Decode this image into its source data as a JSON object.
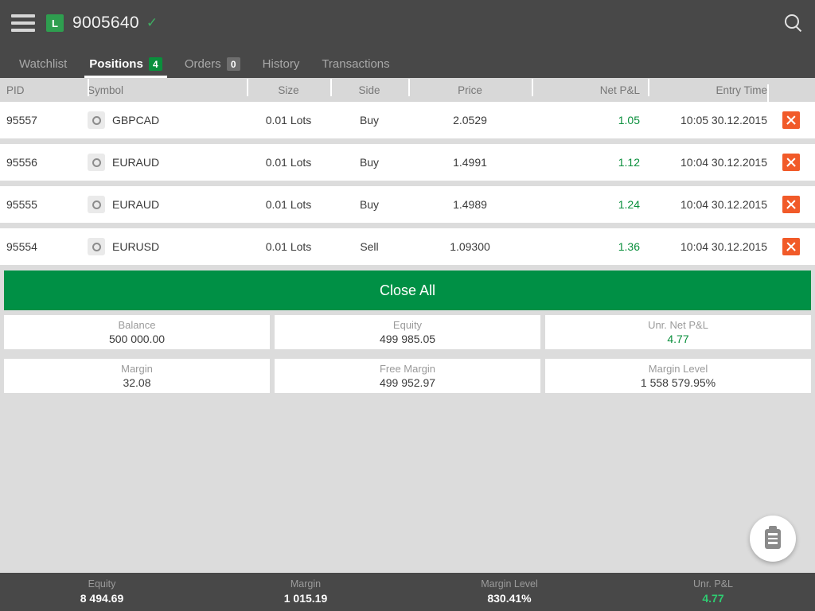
{
  "header": {
    "menu_icon": "hamburger-menu-icon",
    "account_badge": "L",
    "account_number": "9005640",
    "account_check": "✓",
    "search_icon": "search-icon"
  },
  "tabs": [
    {
      "label": "Watchlist",
      "badge": null,
      "active": false
    },
    {
      "label": "Positions",
      "badge": "4",
      "active": true
    },
    {
      "label": "Orders",
      "badge": "0",
      "active": false
    },
    {
      "label": "History",
      "badge": null,
      "active": false
    },
    {
      "label": "Transactions",
      "badge": null,
      "active": false
    }
  ],
  "table": {
    "columns": [
      "PID",
      "Symbol",
      "Size",
      "Side",
      "Price",
      "Net P&L",
      "Entry Time"
    ],
    "rows": [
      {
        "pid": "95557",
        "symbol": "GBPCAD",
        "size": "0.01 Lots",
        "side": "Buy",
        "price": "2.0529",
        "pnl": "1.05",
        "time": "10:05 30.12.2015"
      },
      {
        "pid": "95556",
        "symbol": "EURAUD",
        "size": "0.01 Lots",
        "side": "Buy",
        "price": "1.4991",
        "pnl": "1.12",
        "time": "10:04 30.12.2015"
      },
      {
        "pid": "95555",
        "symbol": "EURAUD",
        "size": "0.01 Lots",
        "side": "Buy",
        "price": "1.4989",
        "pnl": "1.24",
        "time": "10:04 30.12.2015"
      },
      {
        "pid": "95554",
        "symbol": "EURUSD",
        "size": "0.01 Lots",
        "side": "Sell",
        "price": "1.09300",
        "pnl": "1.36",
        "time": "10:04 30.12.2015"
      }
    ]
  },
  "close_all_label": "Close All",
  "summary": [
    {
      "label": "Balance",
      "value": "500 000.00",
      "green": false
    },
    {
      "label": "Equity",
      "value": "499 985.05",
      "green": false
    },
    {
      "label": "Unr. Net P&L",
      "value": "4.77",
      "green": true
    },
    {
      "label": "Margin",
      "value": "32.08",
      "green": false
    },
    {
      "label": "Free Margin",
      "value": "499 952.97",
      "green": false
    },
    {
      "label": "Margin Level",
      "value": "1 558 579.95%",
      "green": false
    }
  ],
  "fab": {
    "icon": "clipboard-icon"
  },
  "statusbar": [
    {
      "label": "Equity",
      "value": "8 494.69",
      "green": false
    },
    {
      "label": "Margin",
      "value": "1 015.19",
      "green": false
    },
    {
      "label": "Margin Level",
      "value": "830.41%",
      "green": false
    },
    {
      "label": "Unr. P&L",
      "value": "4.77",
      "green": true
    }
  ],
  "colors": {
    "accent_green": "#009045",
    "close_orange": "#f15a29",
    "dark_chrome": "#484848",
    "page_bg": "#dcdcdc"
  }
}
